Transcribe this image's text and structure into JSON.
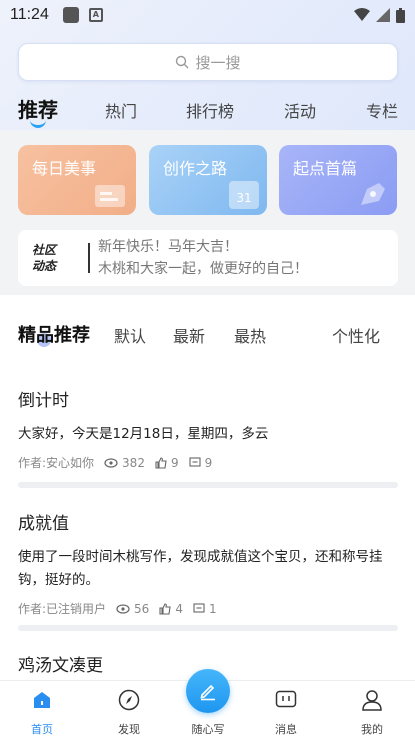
{
  "status": {
    "time": "11:24",
    "badge": "A"
  },
  "search": {
    "placeholder": "搜一搜"
  },
  "tabs": [
    {
      "label": "推荐",
      "active": true
    },
    {
      "label": "热门"
    },
    {
      "label": "排行榜"
    },
    {
      "label": "活动"
    },
    {
      "label": "专栏"
    }
  ],
  "cards": [
    {
      "label": "每日美事",
      "color": "#f4b692"
    },
    {
      "label": "创作之路",
      "color": "#90c3f3",
      "badge": "31"
    },
    {
      "label": "起点首篇",
      "color": "#96a6f5"
    }
  ],
  "notice": {
    "logo_line1": "社区",
    "logo_line2": "动态",
    "line1": "新年快乐！马年大吉！",
    "line2": "木桃和大家一起，做更好的自己！"
  },
  "subtabs": [
    {
      "label": "精品推荐",
      "active": true
    },
    {
      "label": "默认"
    },
    {
      "label": "最新"
    },
    {
      "label": "最热"
    },
    {
      "label": "个性化"
    }
  ],
  "posts": [
    {
      "title": "倒计时",
      "body": "大家好，今天是12月18日，星期四，多云",
      "author": "作者:安心如你",
      "views": "382",
      "likes": "9",
      "comments": "9"
    },
    {
      "title": "成就值",
      "body": "使用了一段时间木桃写作，发现成就值这个宝贝，还和称号挂钩，挺好的。",
      "author": "作者:已注销用户",
      "views": "56",
      "likes": "4",
      "comments": "1"
    },
    {
      "title": "鸡汤文凑更"
    }
  ],
  "nav": [
    {
      "label": "首页",
      "active": true
    },
    {
      "label": "发现"
    },
    {
      "label": "随心写"
    },
    {
      "label": "消息"
    },
    {
      "label": "我的"
    }
  ],
  "colors": {
    "accent": "#2a8ef0",
    "fab": "#1e96f0"
  }
}
